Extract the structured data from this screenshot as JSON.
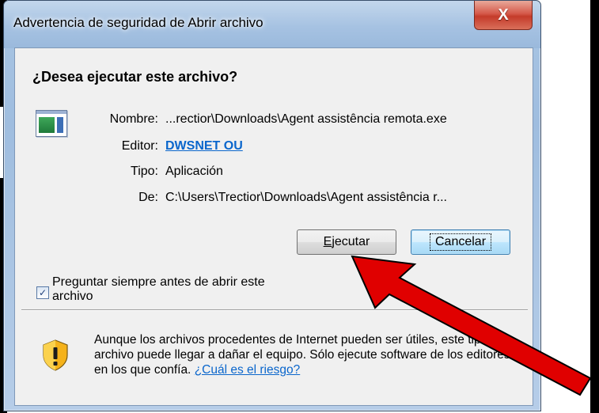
{
  "window": {
    "title": "Advertencia de seguridad de Abrir archivo",
    "close_label": "X"
  },
  "prompt": {
    "question": "¿Desea ejecutar este archivo?"
  },
  "file_info": {
    "icon": "executable-file-icon",
    "fields": [
      {
        "label": "Nombre:",
        "value": "...rectior\\Downloads\\Agent assistência remota.exe"
      },
      {
        "label": "Editor:",
        "value": "DWSNET OU"
      },
      {
        "label": "Tipo:",
        "value": "Aplicación"
      },
      {
        "label": "De:",
        "value": "C:\\Users\\Trectior\\Downloads\\Agent assistência r..."
      }
    ]
  },
  "buttons": {
    "run": "Ejecutar",
    "cancel": "Cancelar"
  },
  "checkbox": {
    "label": "Preguntar siempre antes de abrir este archivo",
    "checked": true
  },
  "warning": {
    "icon": "security-shield-icon",
    "text": "Aunque los archivos procedentes de Internet pueden ser útiles, este tipo de archivo puede llegar a dañar el equipo. Sólo ejecute software de los editores en los que confía.",
    "link": "¿Cuál es el riesgo?"
  },
  "annotation": {
    "icon": "red-arrow-icon",
    "color": "#e00000"
  }
}
